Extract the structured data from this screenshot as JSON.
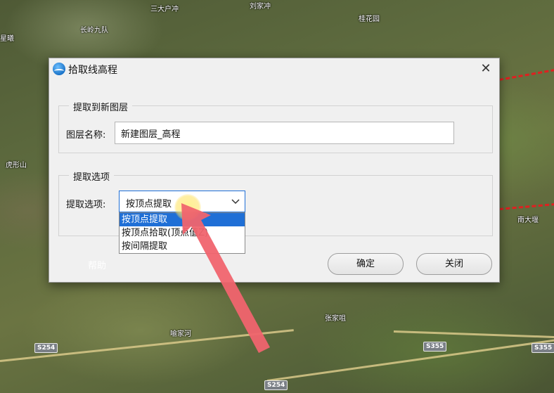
{
  "map": {
    "labels": [
      "三大户冲",
      "刘家冲",
      "长岭九队",
      "桂花园",
      "星曦",
      "虎形山",
      "南大堰",
      "喻家河",
      "张家咀"
    ],
    "roads": [
      "S254",
      "S254",
      "S355",
      "S355"
    ]
  },
  "dialog": {
    "title": "拾取线高程",
    "close_label": "✕",
    "group1": {
      "title": "提取到新图层",
      "layer_name_label": "图层名称:",
      "layer_name_value": "新建图层_高程"
    },
    "group2": {
      "title": "提取选项",
      "option_label": "提取选项:",
      "selected": "按顶点提取",
      "options": [
        "按顶点提取",
        "按顶点拾取(顶点值Z)",
        "按间隔提取"
      ]
    },
    "help_label": "帮助",
    "ok_label": "确定",
    "close_button_label": "关闭"
  },
  "colors": {
    "selection": "#1f6fd6",
    "arrow": "#f0646e",
    "dashed_line": "#e02020"
  },
  "icons": {
    "chevron": "chevron-down-icon",
    "close": "close-icon",
    "app": "app-logo-icon"
  }
}
